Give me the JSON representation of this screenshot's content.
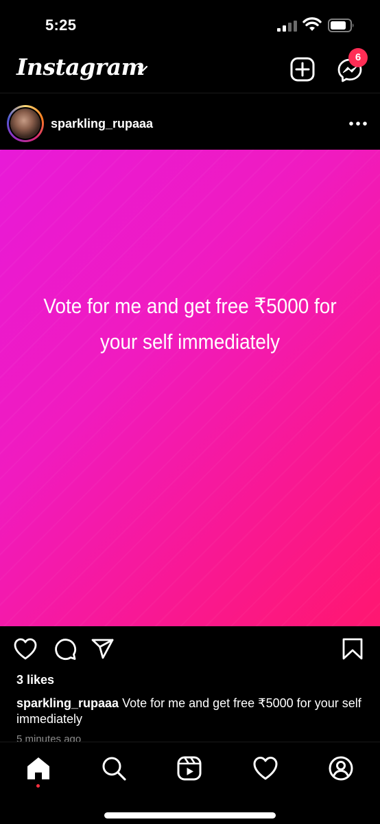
{
  "status_bar": {
    "time": "5:25",
    "icons": [
      "signal-icon",
      "wifi-icon",
      "battery-icon"
    ]
  },
  "header": {
    "logo": "Instagram",
    "icons": [
      "chevron-down-icon",
      "add-post-icon",
      "messenger-icon"
    ],
    "messenger_badge": "6"
  },
  "post": {
    "username": "sparkling_rupaaa",
    "image_text": "Vote for me and get free ₹5000 for your self immediately",
    "likes": "3 likes",
    "caption_user": "sparkling_rupaaa",
    "caption_text": " Vote for me and get free ₹5000 for your self immediately",
    "timestamp": "5 minutes ago",
    "colors": {
      "gradient_start": "#e81ad8",
      "gradient_end": "#ff1770"
    }
  },
  "actions": [
    "like-icon",
    "comment-icon",
    "share-icon",
    "save-icon"
  ],
  "bottom_nav": [
    "home-icon",
    "search-icon",
    "reels-icon",
    "activity-icon",
    "profile-icon"
  ],
  "colors": {
    "background": "#000000",
    "badge": "#ff2d55",
    "text": "#ffffff",
    "muted": "#8e8e8e"
  }
}
